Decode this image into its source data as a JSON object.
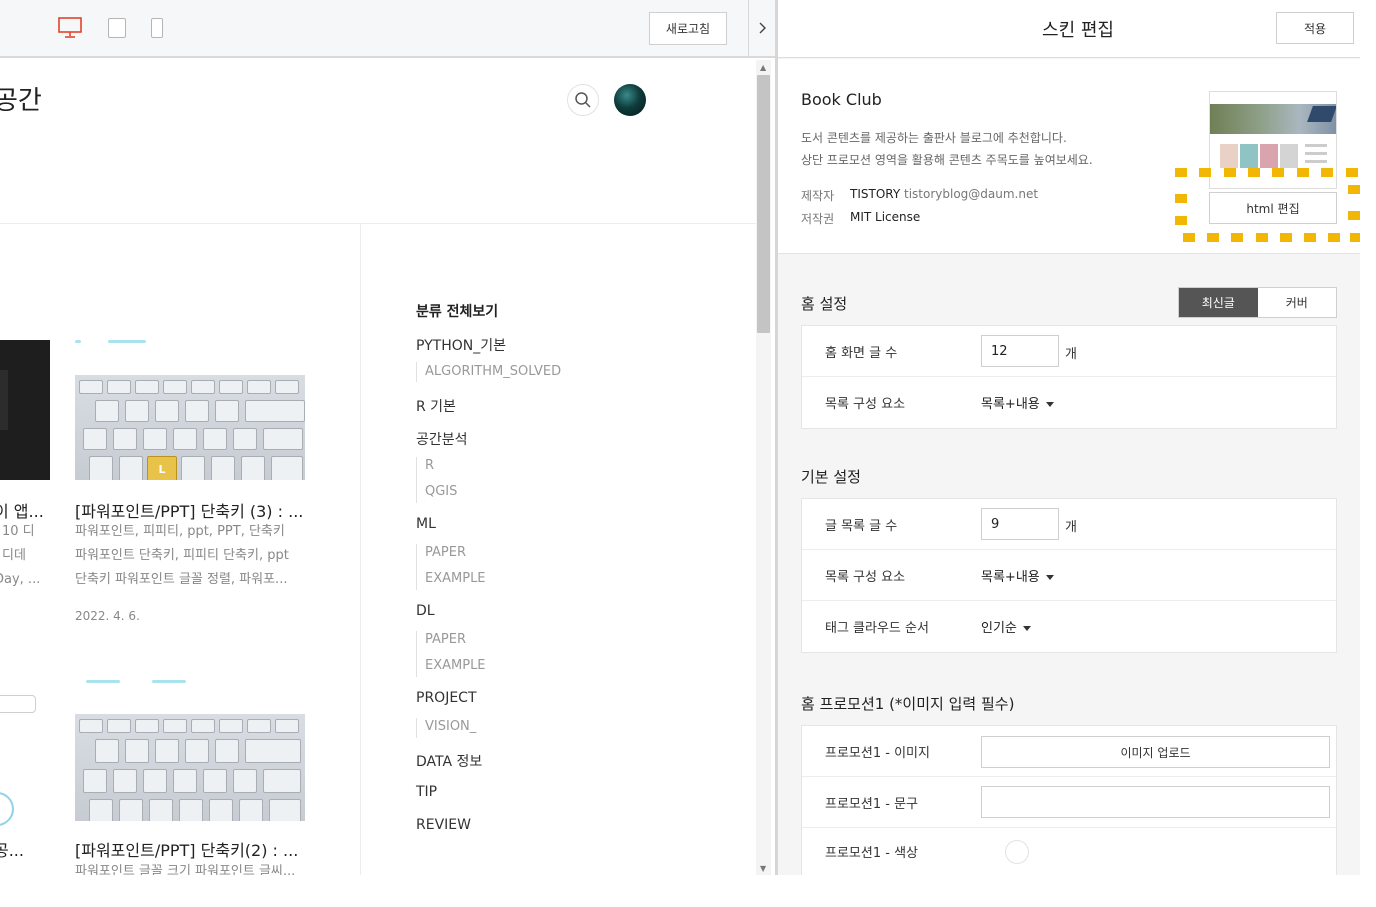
{
  "preview": {
    "toolbar": {
      "refresh_label": "새로고침",
      "device_icons": [
        "desktop-icon",
        "tablet-icon",
        "mobile-icon"
      ],
      "active_device": "desktop",
      "active_color": "#e0452b"
    },
    "blog": {
      "title_fragment": "공간",
      "posts": [
        {
          "title": "[파워포인트/PPT] 단축키 (3) : ...",
          "excerpt": [
            "파워포인트, 피피티, ppt, PPT, 단축키",
            "파워포인트 단축키, 피피티 단축키, ppt",
            "단축키 파워포인트 글꼴 정렬, 파워포..."
          ],
          "date": "2022. 4. 6."
        },
        {
          "title": "[파워포인트/PPT] 단축키(2) : ...",
          "excerpt": [
            "파워포인트 글꼴 크기 파워포인트 글씨..."
          ]
        }
      ],
      "left_cut": {
        "title1": "이 앱...",
        "excerpt1": [
          "10 디",
          "디데",
          "Day, ..."
        ],
        "title2": "공..."
      },
      "keyboard_gold_key": "L",
      "categories": [
        {
          "label": "분류 전체보기",
          "head": true
        },
        {
          "label": "PYTHON_기본",
          "subs": [
            "ALGORITHM_SOLVED"
          ]
        },
        {
          "label": "R 기본"
        },
        {
          "label": "공간분석",
          "subs": [
            "R",
            "QGIS"
          ]
        },
        {
          "label": "ML",
          "subs": [
            "PAPER",
            "EXAMPLE"
          ]
        },
        {
          "label": "DL",
          "subs": [
            "PAPER",
            "EXAMPLE"
          ]
        },
        {
          "label": "PROJECT",
          "subs": [
            "VISION_"
          ]
        },
        {
          "label": "DATA 정보"
        },
        {
          "label": "TIP"
        },
        {
          "label": "REVIEW"
        }
      ]
    }
  },
  "editor": {
    "title": "스킨 편집",
    "apply_label": "적용",
    "skin": {
      "name": "Book Club",
      "description": [
        "도서 콘텐츠를 제공하는 출판사 블로그에 추천합니다.",
        "상단 프로모션 영역을 활용해 콘텐츠 주목도를 높여보세요."
      ],
      "author_label": "제작자",
      "author_name": "TISTORY",
      "author_email": "tistoryblog@daum.net",
      "license_label": "저작권",
      "license_value": "MIT License",
      "html_edit_label": "html 편집",
      "highlight_color": "#f2b705"
    },
    "home_settings": {
      "title": "홈 설정",
      "toggle": [
        "최신글",
        "커버"
      ],
      "rows": [
        {
          "label": "홈 화면 글 수",
          "value": "12",
          "unit": "개"
        },
        {
          "label": "목록 구성 요소",
          "dropdown": "목록+내용"
        }
      ]
    },
    "basic_settings": {
      "title": "기본 설정",
      "rows": [
        {
          "label": "글 목록 글 수",
          "value": "9",
          "unit": "개"
        },
        {
          "label": "목록 구성 요소",
          "dropdown": "목록+내용"
        },
        {
          "label": "태그 클라우드 순서",
          "dropdown": "인기순"
        }
      ]
    },
    "promotion": {
      "title": "홈 프로모션1 (*이미지 입력 필수)",
      "rows": [
        {
          "label": "프로모션1 - 이미지",
          "button": "이미지 업로드"
        },
        {
          "label": "프로모션1 - 문구",
          "text": ""
        },
        {
          "label": "프로모션1 - 색상",
          "color": "#ffffff"
        }
      ]
    }
  }
}
